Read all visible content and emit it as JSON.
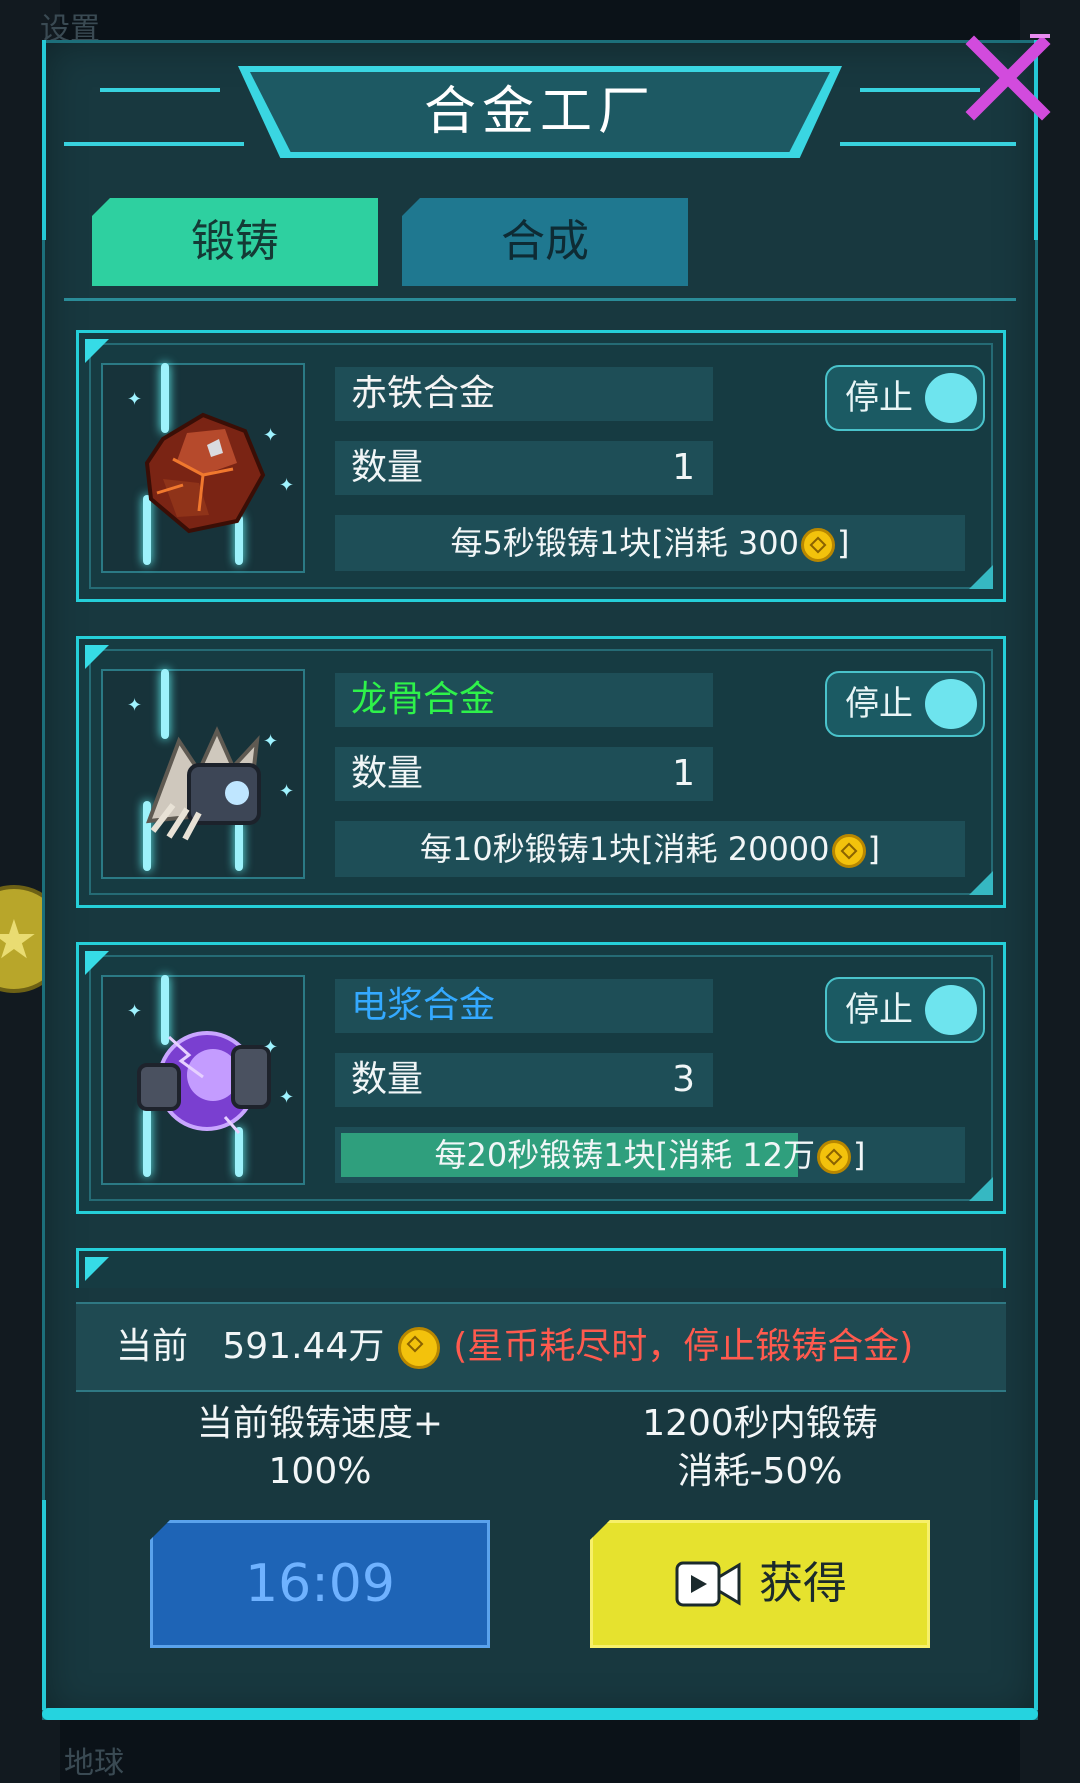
{
  "title": "合金工厂",
  "tabs": {
    "forge": "锻铸",
    "synth": "合成"
  },
  "alloys": [
    {
      "name": "赤铁合金",
      "name_color": "#f4f4f4",
      "qty_label": "数量",
      "qty": "1",
      "rate_pre": "每5秒锻铸1块[消耗 300",
      "rate_post": "]",
      "toggle": "停止",
      "progress": 0,
      "icon": "red-iron-ore-icon"
    },
    {
      "name": "龙骨合金",
      "name_color": "#2ef24a",
      "qty_label": "数量",
      "qty": "1",
      "rate_pre": "每10秒锻铸1块[消耗 20000",
      "rate_post": "]",
      "toggle": "停止",
      "progress": 0,
      "icon": "dragon-bone-icon"
    },
    {
      "name": "电浆合金",
      "name_color": "#34a9ff",
      "qty_label": "数量",
      "qty": "3",
      "rate_pre": "每20秒锻铸1块[消耗 12万",
      "rate_post": "]",
      "toggle": "停止",
      "progress": 0.74,
      "icon": "plasma-orb-icon"
    }
  ],
  "status": {
    "label": "当前",
    "amount": "591.44万",
    "warning": "(星币耗尽时，停止锻铸合金)"
  },
  "boost_speed": {
    "line1": "当前锻铸速度+",
    "line2": "100%"
  },
  "boost_cost": {
    "line1": "1200秒内锻铸",
    "line2": "消耗-50%"
  },
  "timer": "16:09",
  "get_label": "获得",
  "background": {
    "top_label": "设置",
    "bottom_label": "地球"
  }
}
